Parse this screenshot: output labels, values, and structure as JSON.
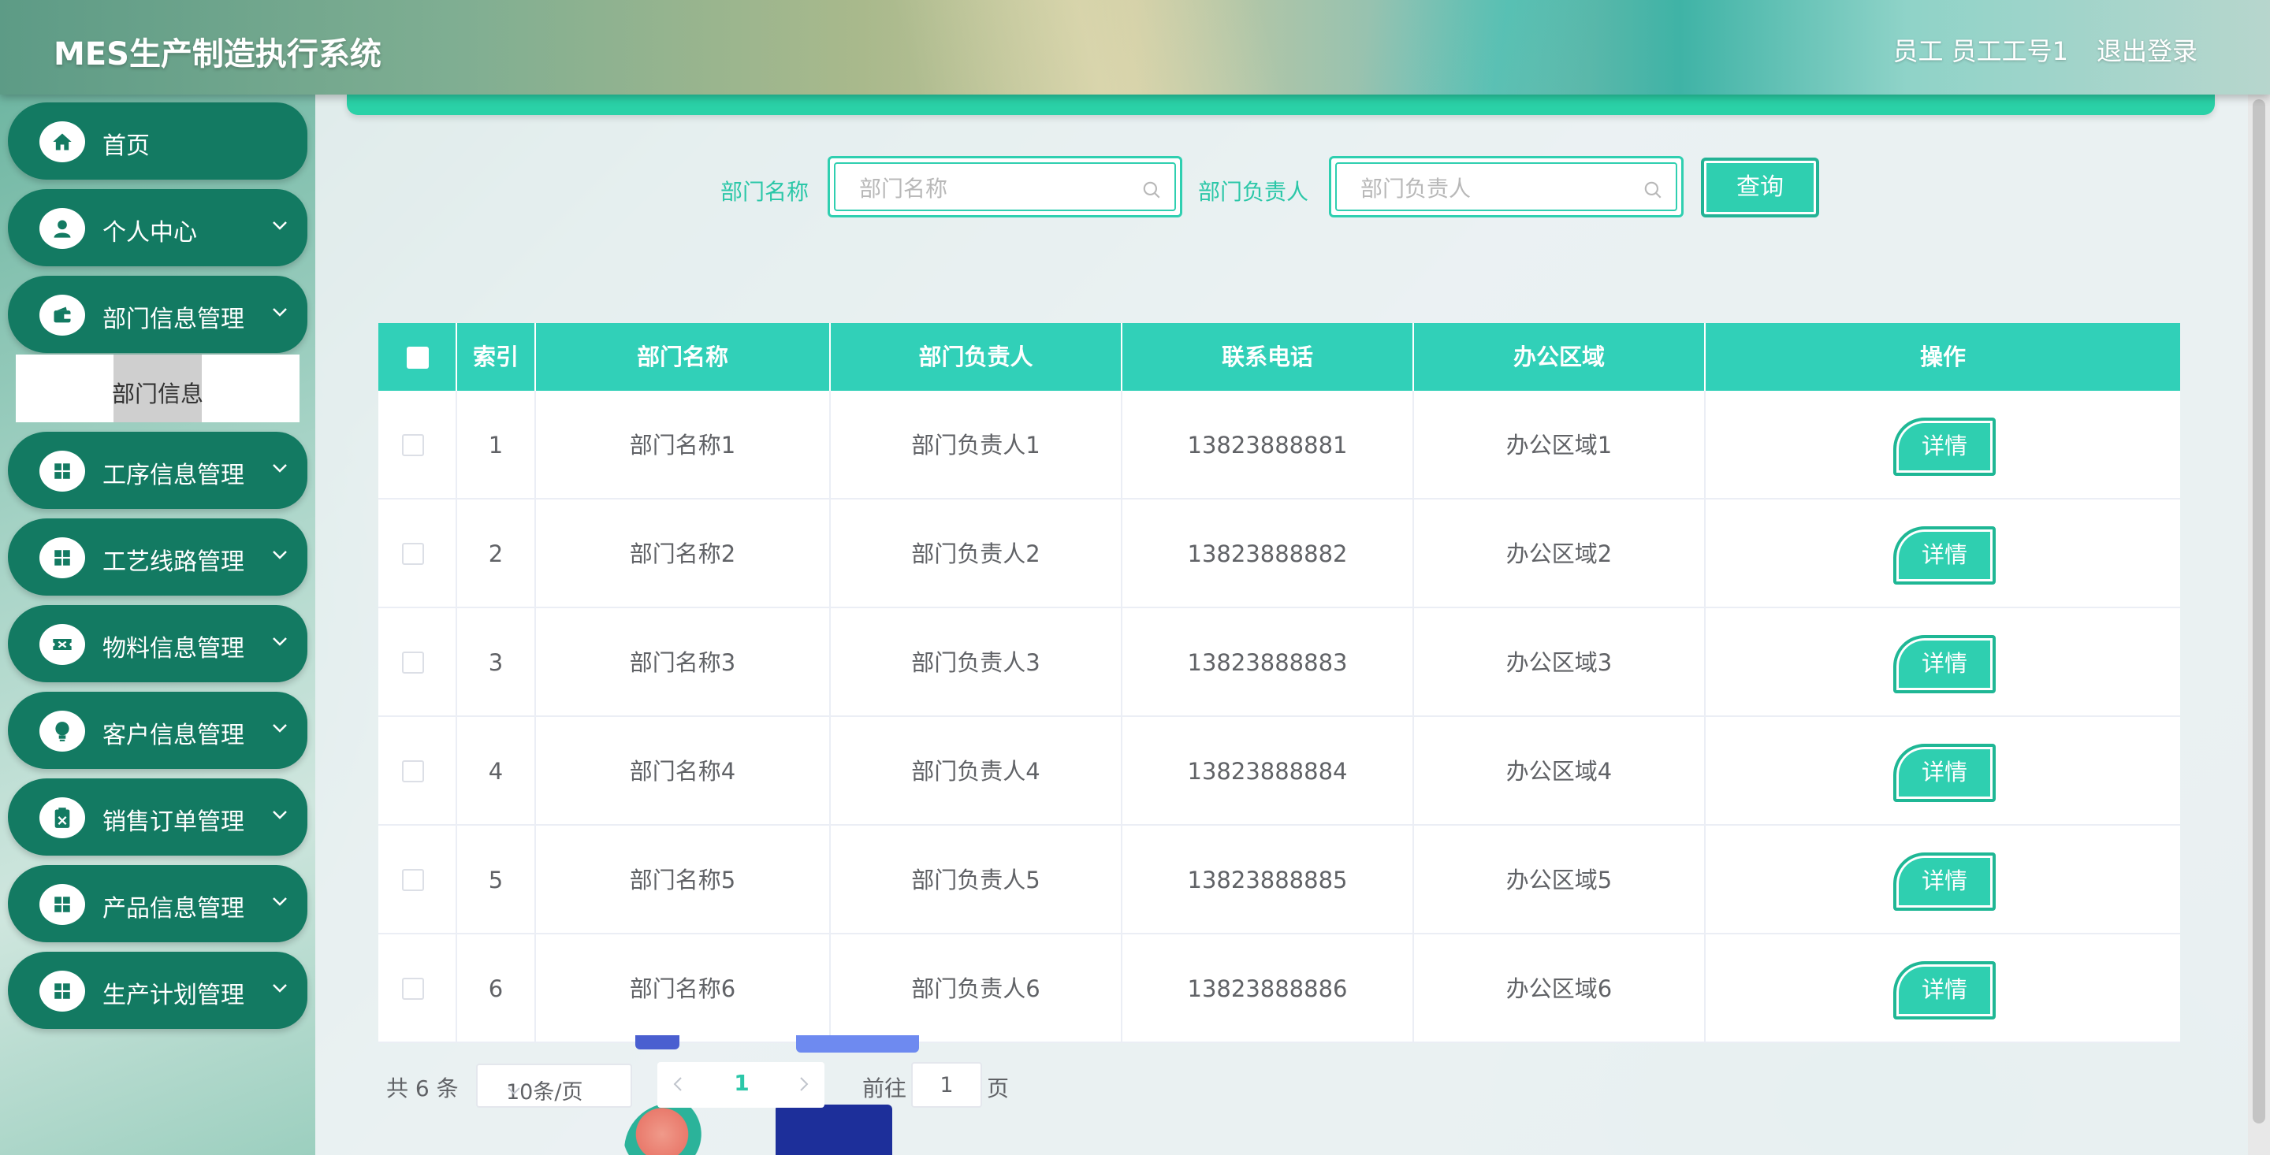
{
  "header": {
    "app_title": "MES生产制造执行系统",
    "user_info": "员工 员工工号1",
    "logout": "退出登录"
  },
  "sidebar": {
    "items": [
      {
        "label": "首页",
        "icon": "home-icon"
      },
      {
        "label": "个人中心",
        "icon": "user-icon"
      },
      {
        "label": "部门信息管理",
        "icon": "wallet-icon"
      },
      {
        "label": "工序信息管理",
        "icon": "grid-icon"
      },
      {
        "label": "工艺线路管理",
        "icon": "grid-icon"
      },
      {
        "label": "物料信息管理",
        "icon": "ticket-icon"
      },
      {
        "label": "客户信息管理",
        "icon": "bulb-icon"
      },
      {
        "label": "销售订单管理",
        "icon": "clipboard-icon"
      },
      {
        "label": "产品信息管理",
        "icon": "grid-icon"
      },
      {
        "label": "生产计划管理",
        "icon": "grid-icon"
      }
    ],
    "submenu_active": "部门信息"
  },
  "search": {
    "dept_name_label": "部门名称",
    "dept_name_placeholder": "部门名称",
    "dept_head_label": "部门负责人",
    "dept_head_placeholder": "部门负责人",
    "query_button": "查询"
  },
  "table": {
    "columns": [
      "",
      "索引",
      "部门名称",
      "部门负责人",
      "联系电话",
      "办公区域",
      "操作"
    ],
    "rows": [
      {
        "index": "1",
        "dept_name": "部门名称1",
        "dept_head": "部门负责人1",
        "phone": "13823888881",
        "area": "办公区域1",
        "action": "详情"
      },
      {
        "index": "2",
        "dept_name": "部门名称2",
        "dept_head": "部门负责人2",
        "phone": "13823888882",
        "area": "办公区域2",
        "action": "详情"
      },
      {
        "index": "3",
        "dept_name": "部门名称3",
        "dept_head": "部门负责人3",
        "phone": "13823888883",
        "area": "办公区域3",
        "action": "详情"
      },
      {
        "index": "4",
        "dept_name": "部门名称4",
        "dept_head": "部门负责人4",
        "phone": "13823888884",
        "area": "办公区域4",
        "action": "详情"
      },
      {
        "index": "5",
        "dept_name": "部门名称5",
        "dept_head": "部门负责人5",
        "phone": "13823888885",
        "area": "办公区域5",
        "action": "详情"
      },
      {
        "index": "6",
        "dept_name": "部门名称6",
        "dept_head": "部门负责人6",
        "phone": "13823888886",
        "area": "办公区域6",
        "action": "详情"
      }
    ]
  },
  "pagination": {
    "total": "共 6 条",
    "page_size": "10条/页",
    "current_page": "1",
    "goto_label": "前往",
    "goto_value": "1",
    "goto_suffix": "页"
  },
  "colors": {
    "accent": "#2fcfb0",
    "sidebar_item": "#137a62",
    "table_header": "#31d0b8"
  }
}
